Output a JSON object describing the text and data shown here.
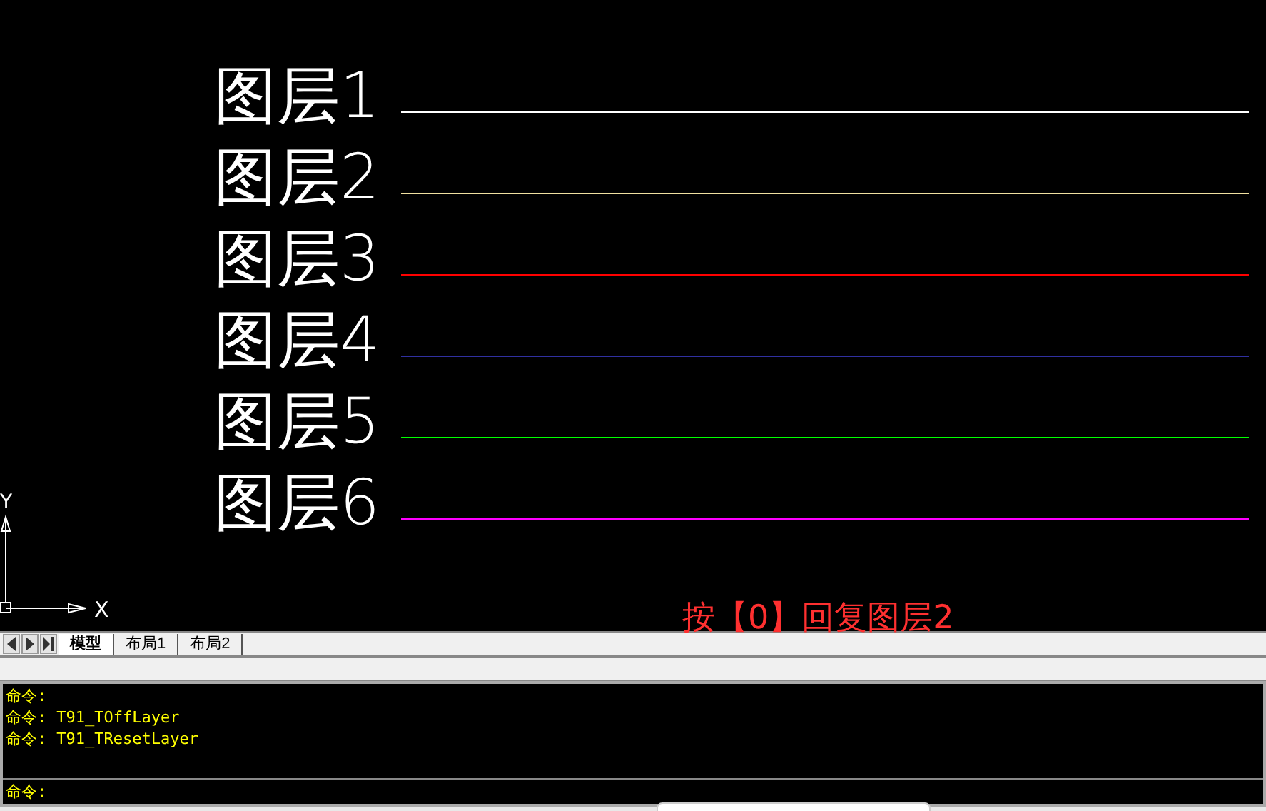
{
  "layers": [
    {
      "label": "图层1",
      "color": "#ffffff"
    },
    {
      "label": "图层2",
      "color": "#f0e0a0"
    },
    {
      "label": "图层3",
      "color": "#ff0000"
    },
    {
      "label": "图层4",
      "color": "#3030a0"
    },
    {
      "label": "图层5",
      "color": "#00ff00"
    },
    {
      "label": "图层6",
      "color": "#ff00ff"
    }
  ],
  "ucs": {
    "x_label": "X",
    "y_label": "Y"
  },
  "annotation": "按【0】回复图层2",
  "tabs": [
    {
      "label": "模型",
      "selected": true
    },
    {
      "label": "布局1",
      "selected": false
    },
    {
      "label": "布局2",
      "selected": false
    }
  ],
  "command_history": [
    {
      "prompt": "命令:"
    },
    {
      "prompt": "命令:",
      "command": "T91_TOffLayer"
    },
    {
      "prompt": "命令:",
      "command": "T91_TResetLayer"
    }
  ],
  "command_line": {
    "prompt": "命令:"
  }
}
